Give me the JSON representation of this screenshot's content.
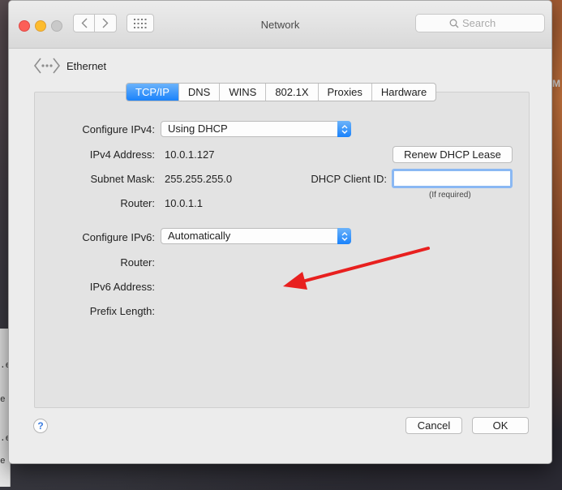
{
  "window": {
    "title": "Network"
  },
  "search": {
    "placeholder": "Search"
  },
  "interface": {
    "name": "Ethernet"
  },
  "tabs": [
    "TCP/IP",
    "DNS",
    "WINS",
    "802.1X",
    "Proxies",
    "Hardware"
  ],
  "ipv4": {
    "configure_label": "Configure IPv4:",
    "configure_value": "Using DHCP",
    "address_label": "IPv4 Address:",
    "address_value": "10.0.1.127",
    "subnet_label": "Subnet Mask:",
    "subnet_value": "255.255.255.0",
    "router_label": "Router:",
    "router_value": "10.0.1.1",
    "renew_button": "Renew DHCP Lease",
    "client_id_label": "DHCP Client ID:",
    "client_id_hint": "(If required)"
  },
  "ipv6": {
    "configure_label": "Configure IPv6:",
    "configure_value": "Automatically",
    "router_label": "Router:",
    "address_label": "IPv6 Address:",
    "prefix_label": "Prefix Length:"
  },
  "footer": {
    "help_label": "?",
    "cancel_button": "Cancel",
    "ok_button": "OK"
  },
  "background": {
    "side_letter": "M",
    "terminal_lines": [
      ".e",
      "e",
      ".e",
      "e"
    ]
  },
  "colors": {
    "accent": "#1a82fb",
    "annotation_arrow": "#e8201f"
  }
}
